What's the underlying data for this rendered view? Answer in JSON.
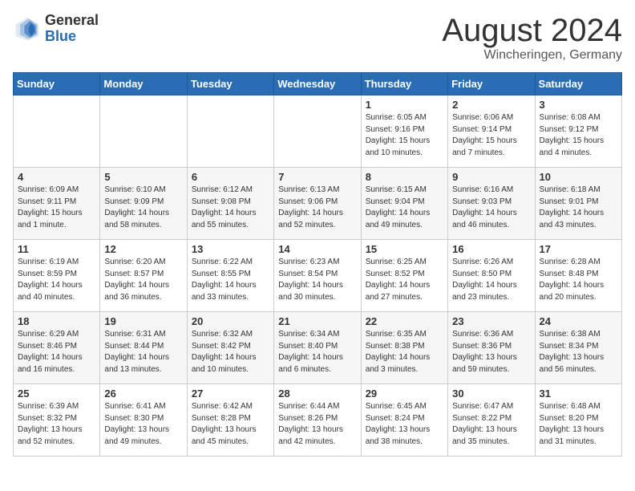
{
  "header": {
    "logo_line1": "General",
    "logo_line2": "Blue",
    "month": "August 2024",
    "location": "Wincheringen, Germany"
  },
  "weekdays": [
    "Sunday",
    "Monday",
    "Tuesday",
    "Wednesday",
    "Thursday",
    "Friday",
    "Saturday"
  ],
  "weeks": [
    [
      {
        "day": "",
        "info": ""
      },
      {
        "day": "",
        "info": ""
      },
      {
        "day": "",
        "info": ""
      },
      {
        "day": "",
        "info": ""
      },
      {
        "day": "1",
        "info": "Sunrise: 6:05 AM\nSunset: 9:16 PM\nDaylight: 15 hours\nand 10 minutes."
      },
      {
        "day": "2",
        "info": "Sunrise: 6:06 AM\nSunset: 9:14 PM\nDaylight: 15 hours\nand 7 minutes."
      },
      {
        "day": "3",
        "info": "Sunrise: 6:08 AM\nSunset: 9:12 PM\nDaylight: 15 hours\nand 4 minutes."
      }
    ],
    [
      {
        "day": "4",
        "info": "Sunrise: 6:09 AM\nSunset: 9:11 PM\nDaylight: 15 hours\nand 1 minute."
      },
      {
        "day": "5",
        "info": "Sunrise: 6:10 AM\nSunset: 9:09 PM\nDaylight: 14 hours\nand 58 minutes."
      },
      {
        "day": "6",
        "info": "Sunrise: 6:12 AM\nSunset: 9:08 PM\nDaylight: 14 hours\nand 55 minutes."
      },
      {
        "day": "7",
        "info": "Sunrise: 6:13 AM\nSunset: 9:06 PM\nDaylight: 14 hours\nand 52 minutes."
      },
      {
        "day": "8",
        "info": "Sunrise: 6:15 AM\nSunset: 9:04 PM\nDaylight: 14 hours\nand 49 minutes."
      },
      {
        "day": "9",
        "info": "Sunrise: 6:16 AM\nSunset: 9:03 PM\nDaylight: 14 hours\nand 46 minutes."
      },
      {
        "day": "10",
        "info": "Sunrise: 6:18 AM\nSunset: 9:01 PM\nDaylight: 14 hours\nand 43 minutes."
      }
    ],
    [
      {
        "day": "11",
        "info": "Sunrise: 6:19 AM\nSunset: 8:59 PM\nDaylight: 14 hours\nand 40 minutes."
      },
      {
        "day": "12",
        "info": "Sunrise: 6:20 AM\nSunset: 8:57 PM\nDaylight: 14 hours\nand 36 minutes."
      },
      {
        "day": "13",
        "info": "Sunrise: 6:22 AM\nSunset: 8:55 PM\nDaylight: 14 hours\nand 33 minutes."
      },
      {
        "day": "14",
        "info": "Sunrise: 6:23 AM\nSunset: 8:54 PM\nDaylight: 14 hours\nand 30 minutes."
      },
      {
        "day": "15",
        "info": "Sunrise: 6:25 AM\nSunset: 8:52 PM\nDaylight: 14 hours\nand 27 minutes."
      },
      {
        "day": "16",
        "info": "Sunrise: 6:26 AM\nSunset: 8:50 PM\nDaylight: 14 hours\nand 23 minutes."
      },
      {
        "day": "17",
        "info": "Sunrise: 6:28 AM\nSunset: 8:48 PM\nDaylight: 14 hours\nand 20 minutes."
      }
    ],
    [
      {
        "day": "18",
        "info": "Sunrise: 6:29 AM\nSunset: 8:46 PM\nDaylight: 14 hours\nand 16 minutes."
      },
      {
        "day": "19",
        "info": "Sunrise: 6:31 AM\nSunset: 8:44 PM\nDaylight: 14 hours\nand 13 minutes."
      },
      {
        "day": "20",
        "info": "Sunrise: 6:32 AM\nSunset: 8:42 PM\nDaylight: 14 hours\nand 10 minutes."
      },
      {
        "day": "21",
        "info": "Sunrise: 6:34 AM\nSunset: 8:40 PM\nDaylight: 14 hours\nand 6 minutes."
      },
      {
        "day": "22",
        "info": "Sunrise: 6:35 AM\nSunset: 8:38 PM\nDaylight: 14 hours\nand 3 minutes."
      },
      {
        "day": "23",
        "info": "Sunrise: 6:36 AM\nSunset: 8:36 PM\nDaylight: 13 hours\nand 59 minutes."
      },
      {
        "day": "24",
        "info": "Sunrise: 6:38 AM\nSunset: 8:34 PM\nDaylight: 13 hours\nand 56 minutes."
      }
    ],
    [
      {
        "day": "25",
        "info": "Sunrise: 6:39 AM\nSunset: 8:32 PM\nDaylight: 13 hours\nand 52 minutes."
      },
      {
        "day": "26",
        "info": "Sunrise: 6:41 AM\nSunset: 8:30 PM\nDaylight: 13 hours\nand 49 minutes."
      },
      {
        "day": "27",
        "info": "Sunrise: 6:42 AM\nSunset: 8:28 PM\nDaylight: 13 hours\nand 45 minutes."
      },
      {
        "day": "28",
        "info": "Sunrise: 6:44 AM\nSunset: 8:26 PM\nDaylight: 13 hours\nand 42 minutes."
      },
      {
        "day": "29",
        "info": "Sunrise: 6:45 AM\nSunset: 8:24 PM\nDaylight: 13 hours\nand 38 minutes."
      },
      {
        "day": "30",
        "info": "Sunrise: 6:47 AM\nSunset: 8:22 PM\nDaylight: 13 hours\nand 35 minutes."
      },
      {
        "day": "31",
        "info": "Sunrise: 6:48 AM\nSunset: 8:20 PM\nDaylight: 13 hours\nand 31 minutes."
      }
    ]
  ]
}
